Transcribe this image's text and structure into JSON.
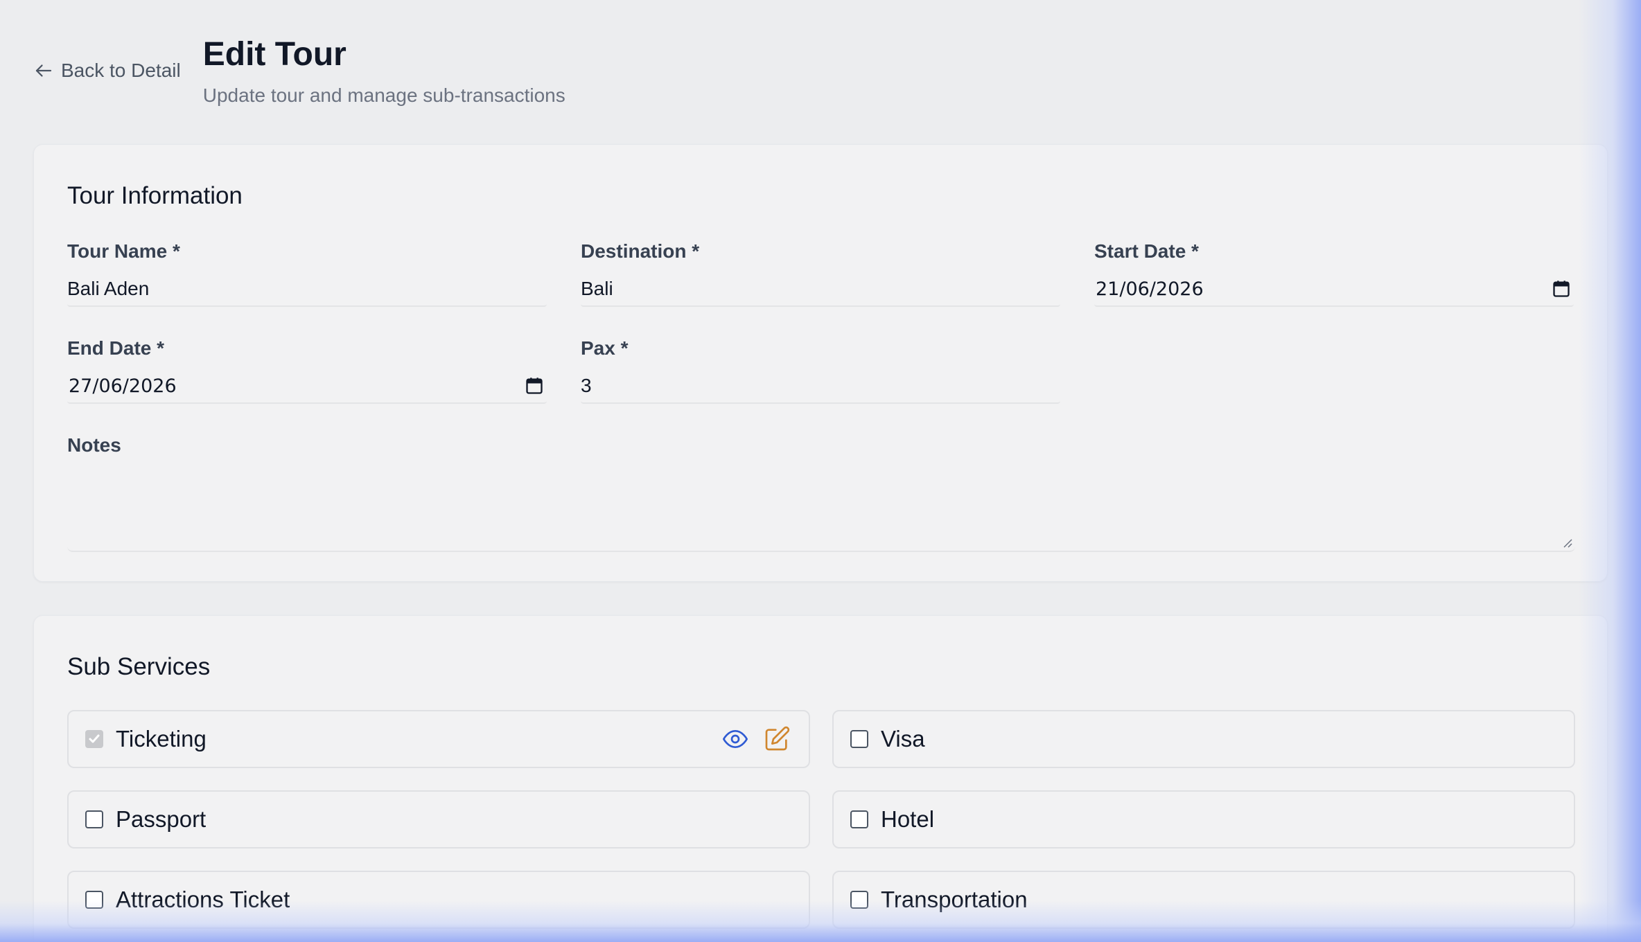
{
  "header": {
    "back_label": "Back to Detail",
    "title": "Edit Tour",
    "subtitle": "Update tour and manage sub-transactions"
  },
  "tour_info": {
    "section_title": "Tour Information",
    "tour_name": {
      "label": "Tour Name *",
      "value": "Bali Aden"
    },
    "destination": {
      "label": "Destination *",
      "value": "Bali"
    },
    "start_date": {
      "label": "Start Date *",
      "value": "21/06/2026"
    },
    "end_date": {
      "label": "End Date *",
      "value": "27/06/2026"
    },
    "pax": {
      "label": "Pax *",
      "value": "3"
    },
    "notes": {
      "label": "Notes",
      "value": ""
    }
  },
  "sub_services": {
    "section_title": "Sub Services",
    "items": [
      {
        "label": "Ticketing",
        "checked": true,
        "icons": [
          "eye-icon",
          "edit-icon"
        ]
      },
      {
        "label": "Visa",
        "checked": false
      },
      {
        "label": "Passport",
        "checked": false
      },
      {
        "label": "Hotel",
        "checked": false
      },
      {
        "label": "Attractions Ticket",
        "checked": false
      },
      {
        "label": "Transportation",
        "checked": false
      }
    ]
  },
  "colors": {
    "view_icon": "#2f5bd3",
    "edit_icon": "#d0862e",
    "glow": "#96aaf5"
  }
}
